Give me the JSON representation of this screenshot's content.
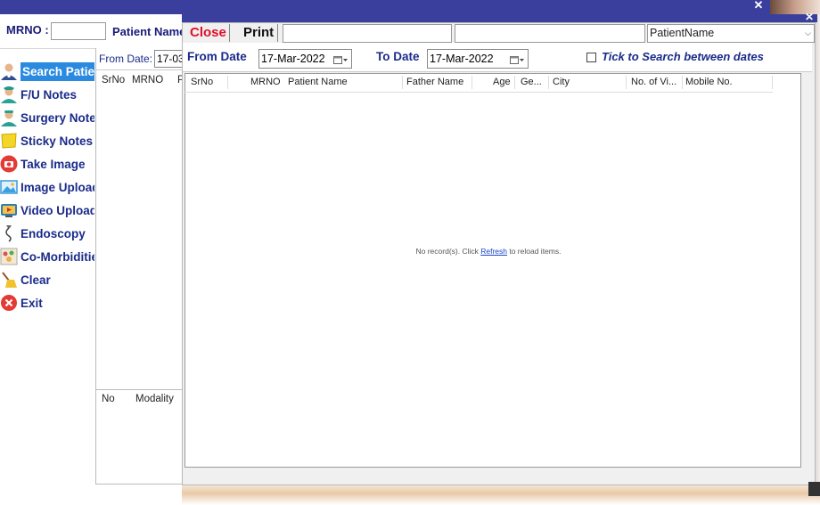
{
  "background_app": {
    "mrno_label": "MRNO :",
    "patient_name_label": "Patient Name",
    "close_glyph": "✕",
    "menu": [
      {
        "label": "Search Patient",
        "icon": "doctor-icon",
        "active": true
      },
      {
        "label": "F/U Notes",
        "icon": "nurse-icon"
      },
      {
        "label": "Surgery Notes",
        "icon": "surgeon-icon"
      },
      {
        "label": "Sticky Notes",
        "icon": "sticky-note-icon"
      },
      {
        "label": "Take Image",
        "icon": "camera-icon"
      },
      {
        "label": "Image Upload",
        "icon": "image-icon"
      },
      {
        "label": "Video Upload",
        "icon": "video-icon"
      },
      {
        "label": "Endoscopy",
        "icon": "endoscope-icon"
      },
      {
        "label": "Co-Morbidities",
        "icon": "comorbidity-icon"
      },
      {
        "label": "Clear",
        "icon": "broom-icon"
      },
      {
        "label": "Exit",
        "icon": "exit-icon"
      }
    ],
    "mid_panel": {
      "from_date_label": "From Date:",
      "from_date_value": "17-03",
      "grid_headers": [
        "SrNo",
        "MRNO",
        "P"
      ],
      "bottom_grid_headers": [
        "No",
        "Modality"
      ]
    }
  },
  "dialog": {
    "close_glyph": "✕",
    "toolbar": {
      "close_label": "Close",
      "print_label": "Print",
      "search_value_1": "",
      "search_value_2": "",
      "field_select_value": "PatientName"
    },
    "date_row": {
      "from_label": "From Date",
      "from_value": "17-Mar-2022",
      "to_label": "To Date",
      "to_value": "17-Mar-2022",
      "tick_label": "Tick to Search between dates",
      "tick_checked": false
    },
    "grid": {
      "columns": [
        "SrNo",
        "MRNO",
        "Patient Name",
        "Father Name",
        "Age",
        "Ge...",
        "City",
        "No. of Vi...",
        "Mobile No."
      ],
      "empty_message_before": "No record(s). Click ",
      "empty_message_link": "Refresh",
      "empty_message_after": " to reload items."
    }
  },
  "colors": {
    "titlebar": "#3a3f9e",
    "label_blue": "#1a2b8a",
    "close_red": "#e0102a",
    "active_menu": "#2a8ae0"
  }
}
